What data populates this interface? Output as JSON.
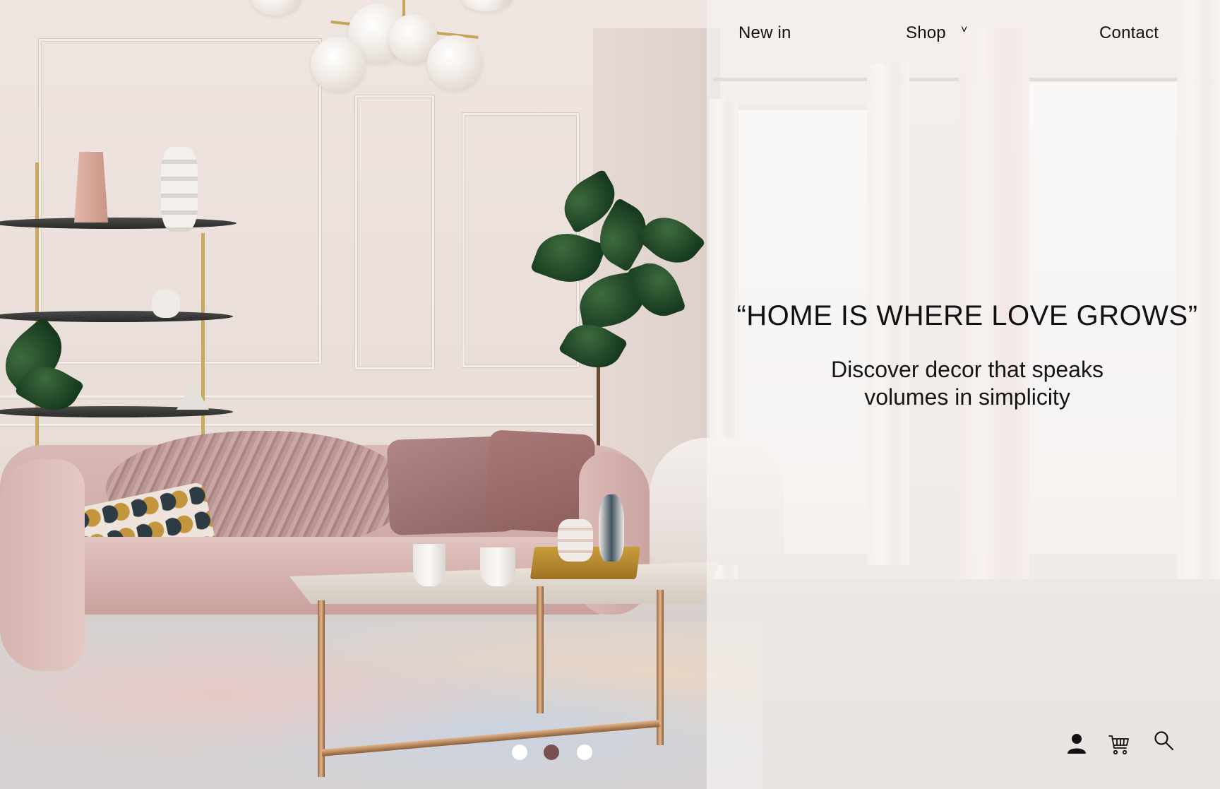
{
  "nav": {
    "new_in": "New in",
    "shop": "Shop",
    "shop_chevron": "˅",
    "contact": "Contact"
  },
  "hero": {
    "headline": "“HOME IS WHERE LOVE GROWS”",
    "subline": "Discover decor that speaks volumes in simplicity"
  },
  "icons": {
    "user": "user-icon",
    "cart": "cart-icon",
    "search": "search-icon"
  },
  "carousel": {
    "slide_count": 3,
    "active_index": 1,
    "active_color": "#7a4f4f",
    "inactive_color": "#ffffff"
  },
  "colors": {
    "text": "#111111",
    "overlay": "rgba(247,245,244,0.62)"
  }
}
